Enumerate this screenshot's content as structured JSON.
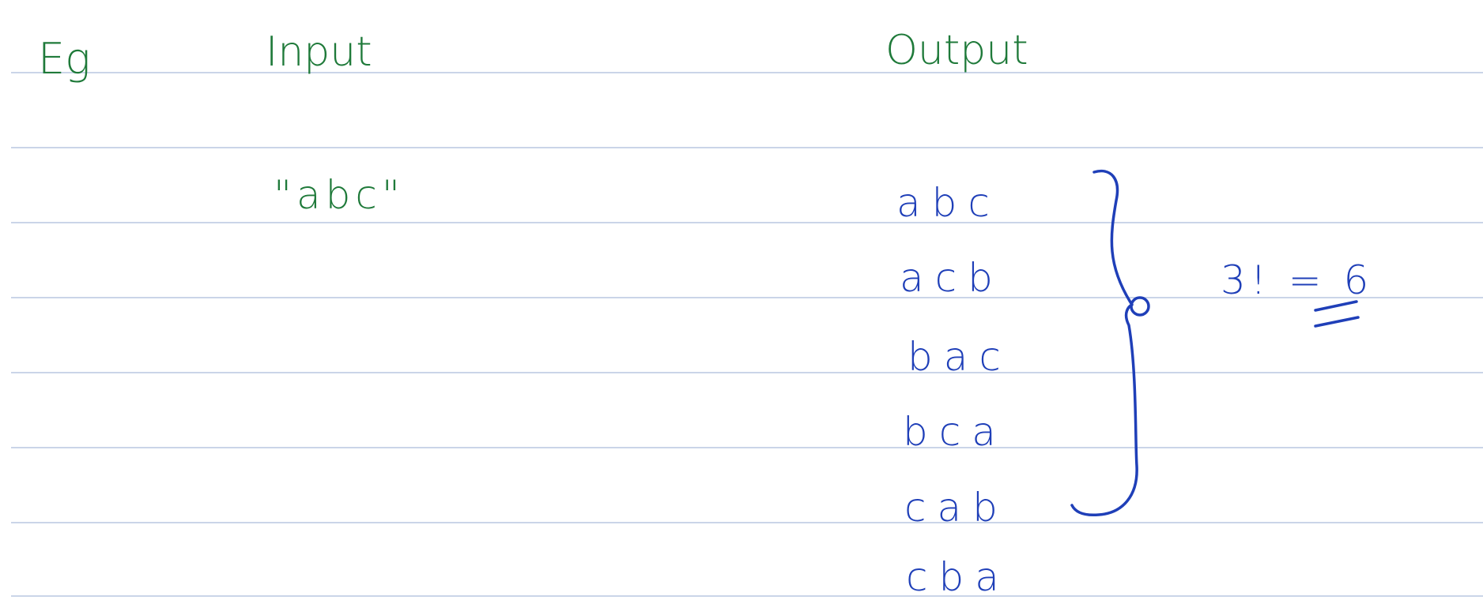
{
  "note": {
    "eg_label": "Eg",
    "input_heading": "Input",
    "output_heading": "Output",
    "input_value": "\"abc\"",
    "output_permutations": [
      "abc",
      "acb",
      "bac",
      "bca",
      "cab",
      "cba"
    ],
    "result": "3! = 6"
  },
  "colors": {
    "ink_green": "#1f7a3a",
    "ink_blue": "#1f3fb8",
    "rule_line": "#b8c7e0",
    "paper": "#ffffff"
  }
}
